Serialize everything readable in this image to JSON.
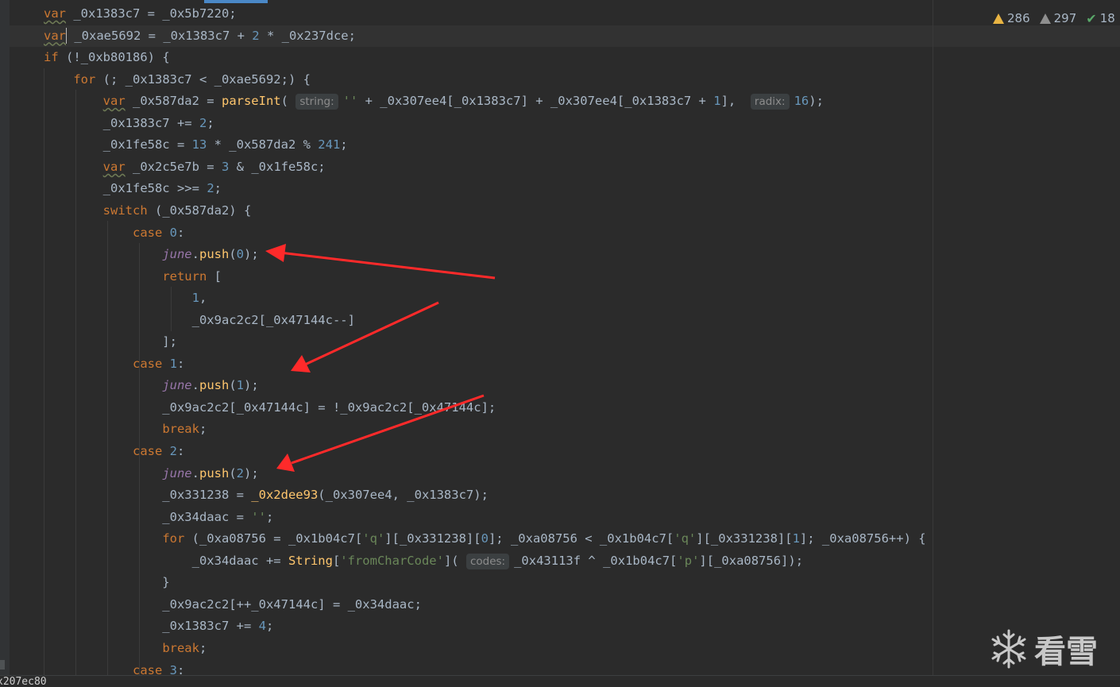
{
  "editor": {
    "lines": [
      {
        "tokens": [
          {
            "t": "var",
            "c": "kw wavy"
          },
          {
            "t": " _0x1383c7 = _0x5b7220;"
          }
        ]
      },
      {
        "tokens": [
          {
            "t": "var",
            "c": "kw wavy"
          },
          {
            "t": "",
            "c": "caret"
          },
          {
            "t": " _0xae5692 = _0x1383c7 + "
          },
          {
            "t": "2",
            "c": "num"
          },
          {
            "t": " * _0x237dce;"
          }
        ]
      },
      {
        "tokens": [
          {
            "t": "if",
            "c": "kw"
          },
          {
            "t": " (!_0xb80186) {"
          }
        ]
      },
      {
        "tokens": [
          {
            "t": "    "
          },
          {
            "t": "for",
            "c": "kw"
          },
          {
            "t": " (; _0x1383c7 < _0xae5692;) {"
          }
        ]
      },
      {
        "tokens": [
          {
            "t": "        "
          },
          {
            "t": "var",
            "c": "kw wavy"
          },
          {
            "t": " _0x587da2 = "
          },
          {
            "t": "parseInt",
            "c": "fn"
          },
          {
            "t": "( "
          },
          {
            "t": "string:",
            "c": "hint"
          },
          {
            "t": "''",
            "c": "str"
          },
          {
            "t": " + _0x307ee4[_0x1383c7] + _0x307ee4[_0x1383c7 + "
          },
          {
            "t": "1",
            "c": "num"
          },
          {
            "t": "],  "
          },
          {
            "t": "radix:",
            "c": "hint"
          },
          {
            "t": "16",
            "c": "num"
          },
          {
            "t": ");"
          }
        ]
      },
      {
        "tokens": [
          {
            "t": "        _0x1383c7 += "
          },
          {
            "t": "2",
            "c": "num"
          },
          {
            "t": ";"
          }
        ]
      },
      {
        "tokens": [
          {
            "t": "        _0x1fe58c = "
          },
          {
            "t": "13",
            "c": "num"
          },
          {
            "t": " * _0x587da2 % "
          },
          {
            "t": "241",
            "c": "num"
          },
          {
            "t": ";"
          }
        ]
      },
      {
        "tokens": [
          {
            "t": "        "
          },
          {
            "t": "var",
            "c": "kw wavy"
          },
          {
            "t": " _0x2c5e7b = "
          },
          {
            "t": "3",
            "c": "num"
          },
          {
            "t": " & _0x1fe58c;"
          }
        ]
      },
      {
        "tokens": [
          {
            "t": "        _0x1fe58c >>= "
          },
          {
            "t": "2",
            "c": "num"
          },
          {
            "t": ";"
          }
        ]
      },
      {
        "tokens": [
          {
            "t": "        "
          },
          {
            "t": "switch",
            "c": "kw"
          },
          {
            "t": " (_0x587da2) {"
          }
        ]
      },
      {
        "tokens": [
          {
            "t": "            "
          },
          {
            "t": "case",
            "c": "kw"
          },
          {
            "t": " "
          },
          {
            "t": "0",
            "c": "num"
          },
          {
            "t": ":"
          }
        ]
      },
      {
        "tokens": [
          {
            "t": "                "
          },
          {
            "t": "june",
            "c": "june"
          },
          {
            "t": "."
          },
          {
            "t": "push",
            "c": "fn"
          },
          {
            "t": "("
          },
          {
            "t": "0",
            "c": "num"
          },
          {
            "t": ");"
          }
        ]
      },
      {
        "tokens": [
          {
            "t": "                "
          },
          {
            "t": "return",
            "c": "kw"
          },
          {
            "t": " ["
          }
        ]
      },
      {
        "tokens": [
          {
            "t": "                    "
          },
          {
            "t": "1",
            "c": "num"
          },
          {
            "t": ","
          }
        ]
      },
      {
        "tokens": [
          {
            "t": "                    _0x9ac2c2[_0x47144c--]"
          }
        ]
      },
      {
        "tokens": [
          {
            "t": "                ];"
          }
        ]
      },
      {
        "tokens": [
          {
            "t": "            "
          },
          {
            "t": "case",
            "c": "kw"
          },
          {
            "t": " "
          },
          {
            "t": "1",
            "c": "num"
          },
          {
            "t": ":"
          }
        ]
      },
      {
        "tokens": [
          {
            "t": "                "
          },
          {
            "t": "june",
            "c": "june"
          },
          {
            "t": "."
          },
          {
            "t": "push",
            "c": "fn"
          },
          {
            "t": "("
          },
          {
            "t": "1",
            "c": "num"
          },
          {
            "t": ");"
          }
        ]
      },
      {
        "tokens": [
          {
            "t": "                _0x9ac2c2[_0x47144c] = !_0x9ac2c2[_0x47144c];"
          }
        ]
      },
      {
        "tokens": [
          {
            "t": "                "
          },
          {
            "t": "break",
            "c": "kw"
          },
          {
            "t": ";"
          }
        ]
      },
      {
        "tokens": [
          {
            "t": "            "
          },
          {
            "t": "case",
            "c": "kw"
          },
          {
            "t": " "
          },
          {
            "t": "2",
            "c": "num"
          },
          {
            "t": ":"
          }
        ]
      },
      {
        "tokens": [
          {
            "t": "                "
          },
          {
            "t": "june",
            "c": "june"
          },
          {
            "t": "."
          },
          {
            "t": "push",
            "c": "fn"
          },
          {
            "t": "("
          },
          {
            "t": "2",
            "c": "num"
          },
          {
            "t": ");"
          }
        ]
      },
      {
        "tokens": [
          {
            "t": "                _0x331238 = "
          },
          {
            "t": "_0x2dee93",
            "c": "fn"
          },
          {
            "t": "(_0x307ee4, _0x1383c7);"
          }
        ]
      },
      {
        "tokens": [
          {
            "t": "                _0x34daac = "
          },
          {
            "t": "''",
            "c": "str"
          },
          {
            "t": ";"
          }
        ]
      },
      {
        "tokens": [
          {
            "t": "                "
          },
          {
            "t": "for",
            "c": "kw"
          },
          {
            "t": " (_0xa08756 = _0x1b04c7["
          },
          {
            "t": "'q'",
            "c": "str"
          },
          {
            "t": "][_0x331238]["
          },
          {
            "t": "0",
            "c": "num"
          },
          {
            "t": "]; _0xa08756 < _0x1b04c7["
          },
          {
            "t": "'q'",
            "c": "str"
          },
          {
            "t": "][_0x331238]["
          },
          {
            "t": "1",
            "c": "num"
          },
          {
            "t": "]; _0xa08756++) {"
          }
        ]
      },
      {
        "tokens": [
          {
            "t": "                    _0x34daac += "
          },
          {
            "t": "String",
            "c": "fn"
          },
          {
            "t": "["
          },
          {
            "t": "'fromCharCode'",
            "c": "str"
          },
          {
            "t": "]( "
          },
          {
            "t": "codes:",
            "c": "hint"
          },
          {
            "t": "_0x43113f ^ _0x1b04c7["
          },
          {
            "t": "'p'",
            "c": "str"
          },
          {
            "t": "][_0xa08756]);"
          }
        ]
      },
      {
        "tokens": [
          {
            "t": "                }"
          }
        ]
      },
      {
        "tokens": [
          {
            "t": "                _0x9ac2c2[++_0x47144c] = _0x34daac;"
          }
        ]
      },
      {
        "tokens": [
          {
            "t": "                _0x1383c7 += "
          },
          {
            "t": "4",
            "c": "num"
          },
          {
            "t": ";"
          }
        ]
      },
      {
        "tokens": [
          {
            "t": "                "
          },
          {
            "t": "break",
            "c": "kw"
          },
          {
            "t": ";"
          }
        ]
      },
      {
        "tokens": [
          {
            "t": "            "
          },
          {
            "t": "case",
            "c": "kw"
          },
          {
            "t": " "
          },
          {
            "t": "3",
            "c": "num"
          },
          {
            "t": ":"
          }
        ]
      }
    ]
  },
  "inspections": {
    "warnings": "286",
    "weak_warnings": "297",
    "ok": "18"
  },
  "status_bar": {
    "text": "x207ec80"
  },
  "watermark": {
    "text": "看雪"
  },
  "colors": {
    "background": "#2b2b2b",
    "keyword": "#cc7832",
    "number": "#6897bb",
    "string": "#6a8759",
    "function": "#ffc66d",
    "annotation_arrow": "#ff2a2a"
  }
}
